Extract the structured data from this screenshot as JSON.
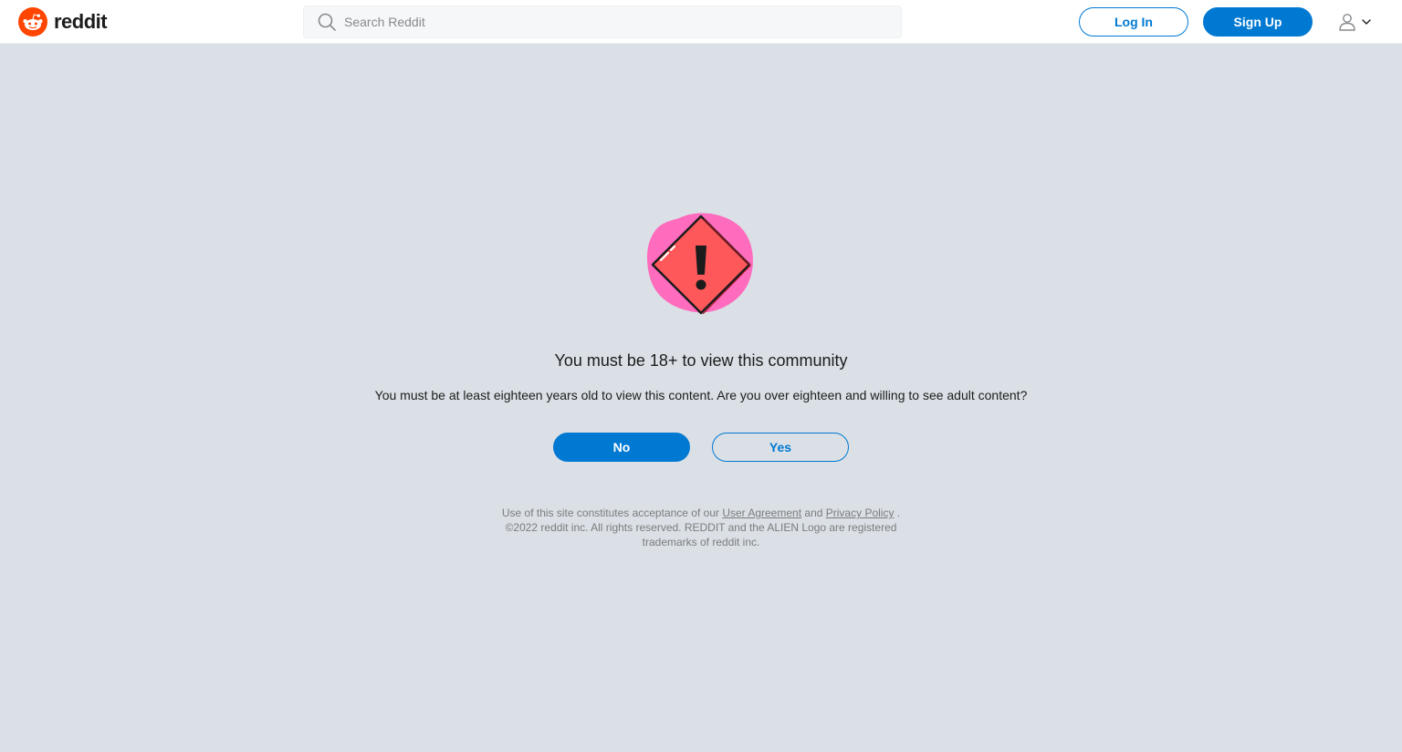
{
  "header": {
    "logo_text": "reddit",
    "search_placeholder": "Search Reddit",
    "login_label": "Log In",
    "signup_label": "Sign Up",
    "icons": [
      "reddit-alien-logo",
      "search-icon",
      "user-icon",
      "chevron-down-icon"
    ]
  },
  "gate": {
    "illustration": "warning-sign",
    "title": "You must be 18+ to view this community",
    "body": "You must be at least eighteen years old to view this content. Are you over eighteen and willing to see adult content?",
    "no_label": "No",
    "yes_label": "Yes"
  },
  "legal": {
    "prefix": "Use of this site constitutes acceptance of our",
    "user_agreement": "User Agreement",
    "and": "and",
    "privacy_policy": "Privacy Policy",
    "period": ".",
    "copyright": "©2022 reddit inc. All rights reserved. REDDIT and the ALIEN Logo are registered trademarks of reddit inc."
  },
  "colors": {
    "brand": "#ff4500",
    "primary": "#0079d3",
    "background": "#dae0e6",
    "warning_red": "#ff585b",
    "warning_pink": "#ff6bbd"
  }
}
